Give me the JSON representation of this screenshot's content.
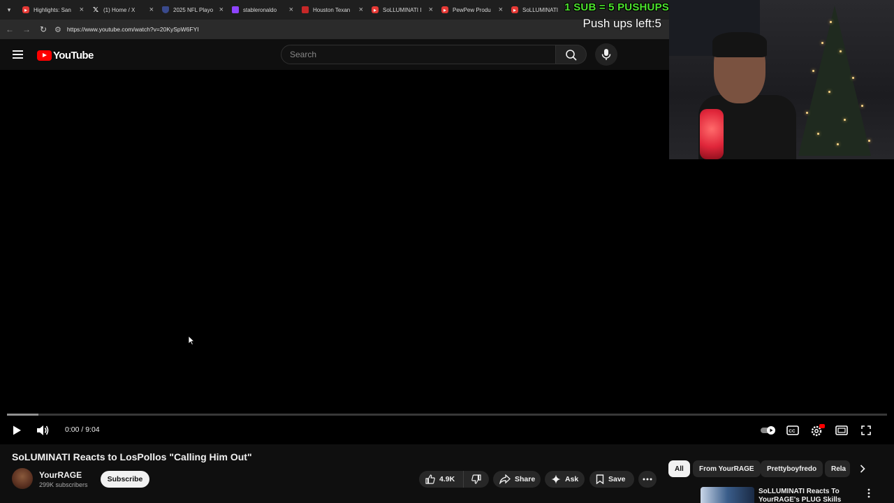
{
  "browser": {
    "tabs": [
      {
        "label": "Highlights: San",
        "favicon_color": "#e53935",
        "favicon": "yt"
      },
      {
        "label": "(1) Home / X",
        "favicon_color": "#1f1f1f",
        "favicon": "x"
      },
      {
        "label": "2025 NFL Playo",
        "favicon_color": "#3a4a8c",
        "favicon": "nfl"
      },
      {
        "label": "stableronaldo",
        "favicon_color": "#8e44ff",
        "favicon": "twitch"
      },
      {
        "label": "Houston Texan",
        "favicon_color": "#c62828",
        "favicon": "espn"
      },
      {
        "label": "SoLLUMINATI I",
        "favicon_color": "#e53935",
        "favicon": "yt"
      },
      {
        "label": "PewPew Produ",
        "favicon_color": "#e53935",
        "favicon": "yt"
      },
      {
        "label": "SoLLUMINATI",
        "favicon_color": "#e53935",
        "favicon": "yt"
      }
    ],
    "url": "https://www.youtube.com/watch?v=20KySpW6FYI"
  },
  "youtube": {
    "logo_text": "YouTube",
    "search_placeholder": "Search"
  },
  "player": {
    "time_display": "0:00 / 9:04",
    "progress_fraction": 0.0,
    "buffered_fraction": 0.036
  },
  "overlay": {
    "sub_goal": "1 SUB = 5 PUSHUPS",
    "pushups_left": "Push ups left:5"
  },
  "video": {
    "title": "SoLUMINATI Reacts to LosPollos \"Calling Him Out\"",
    "channel": "YourRAGE",
    "subscribers": "299K subscribers",
    "subscribe_label": "Subscribe",
    "likes": "4.9K",
    "share_label": "Share",
    "ask_label": "Ask",
    "save_label": "Save"
  },
  "sidebar": {
    "chips": [
      "All",
      "From YourRAGE",
      "Prettyboyfredo",
      "Rela"
    ],
    "recommended_title": "SoLLUMINATI Reacts To YourRAGE's PLUG Skills"
  },
  "colors": {
    "accent": "#ff0000",
    "overlay_green": "#4ce22d"
  }
}
